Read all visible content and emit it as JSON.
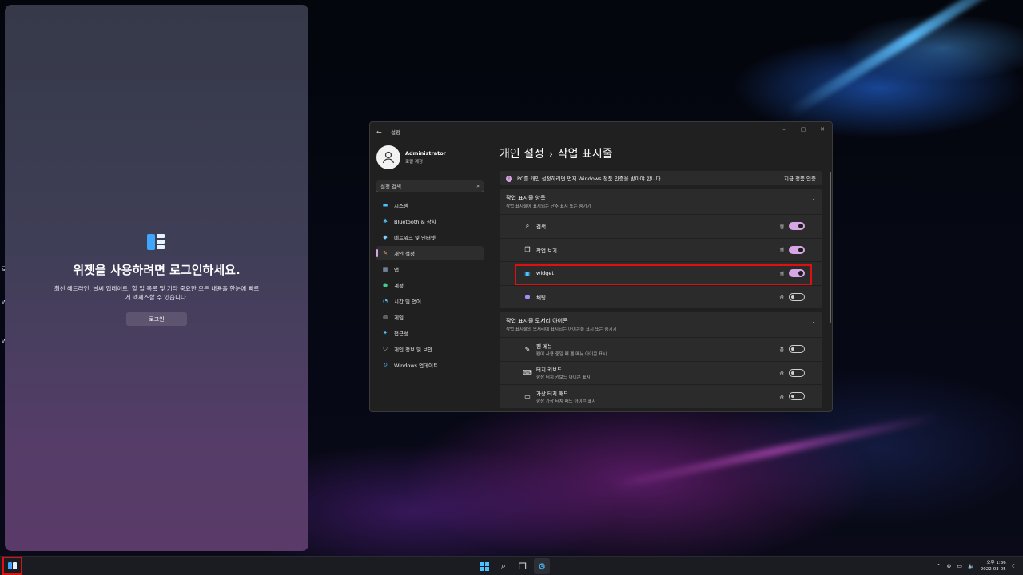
{
  "widget_panel": {
    "title": "위젯을 사용하려면 로그인하세요.",
    "description": "최신 헤드라인, 날씨 업데이트, 할 일 목록 및 기타 중요한 모든 내용을 한눈에 빠르게 액세스할 수 있습니다.",
    "login_label": "로그인"
  },
  "edge_letters": [
    "로",
    "W",
    "W"
  ],
  "settings": {
    "title": "설정",
    "back_icon": "back-arrow-icon",
    "controls": [
      "–",
      "▢",
      "✕"
    ],
    "user": {
      "name": "Administrator",
      "account": "로컬 계정"
    },
    "search_placeholder": "설정 검색",
    "nav": [
      {
        "label": "시스템",
        "icon": "system-icon"
      },
      {
        "label": "Bluetooth & 장치",
        "icon": "bluetooth-icon"
      },
      {
        "label": "네트워크 및 인터넷",
        "icon": "network-icon"
      },
      {
        "label": "개인 설정",
        "icon": "brush-icon"
      },
      {
        "label": "앱",
        "icon": "apps-icon"
      },
      {
        "label": "계정",
        "icon": "account-icon"
      },
      {
        "label": "시간 및 언어",
        "icon": "time-language-icon"
      },
      {
        "label": "게임",
        "icon": "gaming-icon"
      },
      {
        "label": "접근성",
        "icon": "accessibility-icon"
      },
      {
        "label": "개인 정보 및 보안",
        "icon": "shield-icon"
      },
      {
        "label": "Windows 업데이트",
        "icon": "windows-update-icon"
      }
    ],
    "breadcrumb": {
      "parent": "개인 설정",
      "separator": "›",
      "current": "작업 표시줄"
    },
    "activation": {
      "message": "PC를 개인 설정하려면 먼저 Windows 정품 인증을 받아야 합니다.",
      "action": "지금 정품 인증"
    },
    "taskbar_items": {
      "title": "작업 표시줄 항목",
      "subtitle": "작업 표시줄에 표시되는 단추 표시 또는 숨기기",
      "rows": [
        {
          "label": "검색",
          "state": "켬",
          "on": true,
          "icon": "search-icon"
        },
        {
          "label": "작업 보기",
          "state": "켬",
          "on": true,
          "icon": "task-view-icon"
        },
        {
          "label": "widget",
          "state": "켬",
          "on": true,
          "icon": "widgets-icon"
        },
        {
          "label": "채팅",
          "state": "끔",
          "on": false,
          "icon": "chat-icon"
        }
      ]
    },
    "corner_icons": {
      "title": "작업 표시줄 모서리 아이콘",
      "subtitle": "작업 표시줄의 모서리에 표시되는 아이콘을 표시 또는 숨기기",
      "rows": [
        {
          "label": "펜 메뉴",
          "sub": "펜이 사용 중일 때 펜 메뉴 아이콘 표시",
          "state": "끔",
          "on": false,
          "icon": "pen-icon"
        },
        {
          "label": "터치 키보드",
          "sub": "항상 터치 키보드 아이콘 표시",
          "state": "끔",
          "on": false,
          "icon": "keyboard-icon"
        },
        {
          "label": "가상 터치 패드",
          "sub": "항상 가상 터치 패드 아이콘 표시",
          "state": "끔",
          "on": false,
          "icon": "touchpad-icon"
        }
      ]
    }
  },
  "taskbar": {
    "clock_ampm": "오후 1:36",
    "clock_date": "2022-03-05"
  },
  "colors": {
    "accent": "#d8a6e6",
    "highlight": "#e01010",
    "windows_blue": "#4cc2ff"
  }
}
